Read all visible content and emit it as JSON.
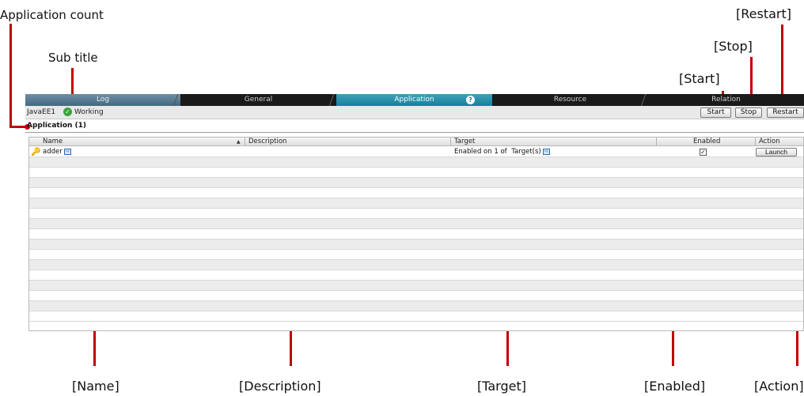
{
  "annotations": {
    "application_count": "Application count",
    "sub_title": "Sub title",
    "restart": "[Restart]",
    "stop": "[Stop]",
    "start": "[Start]",
    "name": "[Name]",
    "description": "[Description]",
    "target": "[Target]",
    "enabled": "[Enabled]",
    "action": "[Action]"
  },
  "tabs": [
    {
      "label": "Log"
    },
    {
      "label": "General"
    },
    {
      "label": "Application",
      "help_icon": "help-icon",
      "help_glyph": "?"
    },
    {
      "label": "Resource"
    },
    {
      "label": "Relation"
    }
  ],
  "status": {
    "server_name": "JavaEE1",
    "state_icon": "check-circle-icon",
    "state": "Working"
  },
  "buttons": {
    "start": "Start",
    "stop": "Stop",
    "restart": "Restart"
  },
  "section_title": "Application (1)",
  "table": {
    "columns": [
      "Name",
      "Description",
      "Target",
      "Enabled",
      "Action"
    ],
    "sort_indicator": "▲",
    "rows": [
      {
        "name": "adder",
        "icon": "key-icon",
        "description": "",
        "target_prefix": "Enabled on 1 of",
        "target_suffix": "Target(s)",
        "enabled": true,
        "action": "Launch"
      }
    ],
    "empty_row_count": 16
  },
  "colors": {
    "accent_red": "#c00000",
    "active_tab": "#167f9c",
    "log_tab": "#46677f",
    "tab_bar": "#1a1a1a"
  }
}
